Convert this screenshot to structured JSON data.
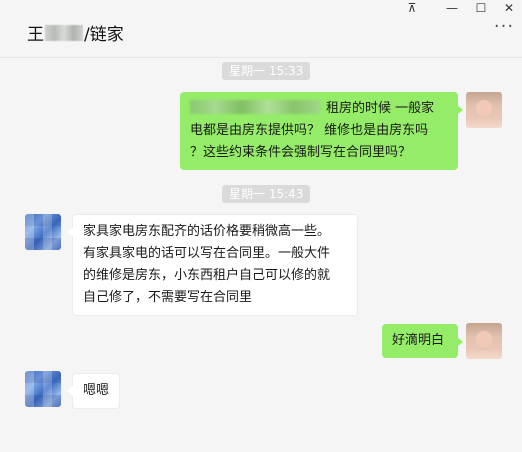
{
  "window": {
    "title_prefix": "王",
    "title_suffix": "/链家",
    "controls": {
      "pin": "⊼",
      "minimize": "—",
      "maximize": "☐",
      "close": "✕"
    },
    "more": "···"
  },
  "messages": [
    {
      "type": "timestamp",
      "text": "星期一 15:33"
    },
    {
      "type": "message",
      "sender": "me",
      "lines": [
        "租房的时候 一般家",
        "电都是由房东提供吗？ 维修也是由房东吗",
        "？这些约束条件会强制写在合同里吗？"
      ]
    },
    {
      "type": "timestamp",
      "text": "星期一 15:43"
    },
    {
      "type": "message",
      "sender": "other",
      "lines": [
        "家具家电房东配齐的话价格要稍微高一些。",
        "有家具家电的话可以写在合同里。一般大件",
        "的维修是房东，小东西租户自己可以修的就",
        "自己修了，不需要写在合同里"
      ]
    },
    {
      "type": "message",
      "sender": "me",
      "lines": [
        "好滴明白"
      ]
    },
    {
      "type": "message",
      "sender": "other",
      "lines": [
        "嗯嗯"
      ]
    }
  ],
  "colors": {
    "bubble_me": "#95ec69",
    "bubble_other": "#ffffff",
    "timestamp_bg": "#dadada",
    "background": "#f5f5f5"
  }
}
